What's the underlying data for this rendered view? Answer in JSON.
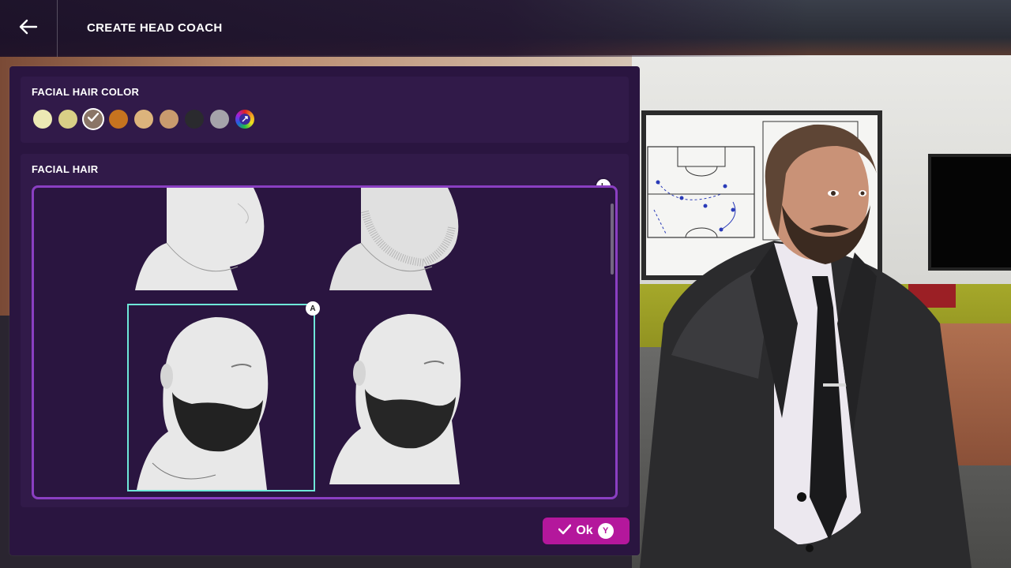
{
  "header": {
    "title": "CREATE HEAD COACH",
    "back_icon": "arrow-left-icon"
  },
  "facial_hair_color": {
    "label": "FACIAL HAIR COLOR",
    "swatches": [
      {
        "color": "#ece9b4",
        "selected": false
      },
      {
        "color": "#d9cf86",
        "selected": false
      },
      {
        "color": "#8a7566",
        "selected": true
      },
      {
        "color": "#c6731f",
        "selected": false
      },
      {
        "color": "#dcb47c",
        "selected": false
      },
      {
        "color": "#c99b6e",
        "selected": false
      },
      {
        "color": "#2a2a2e",
        "selected": false
      },
      {
        "color": "#a5a3aa",
        "selected": false
      },
      {
        "color": "custom-gradient",
        "selected": false,
        "icon": "custom-color-icon"
      }
    ]
  },
  "facial_hair": {
    "label": "FACIAL HAIR",
    "scroll_badge": "L",
    "options": [
      {
        "name": "clean-shaven",
        "selected": false
      },
      {
        "name": "stubble",
        "selected": false
      },
      {
        "name": "full-beard",
        "selected": true,
        "badge": "A"
      },
      {
        "name": "full-beard-trimmed",
        "selected": false
      }
    ]
  },
  "footer": {
    "ok_label": "Ok",
    "ok_badge": "Y"
  }
}
